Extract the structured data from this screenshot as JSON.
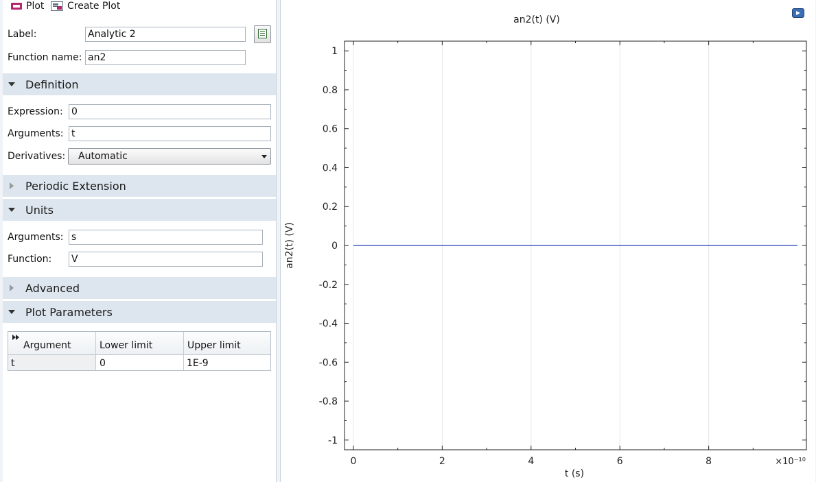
{
  "toolbar": {
    "plot_label": "Plot",
    "plot_icon": "plot-icon",
    "create_plot_label": "Create Plot",
    "create_plot_icon": "create-plot-icon"
  },
  "form": {
    "label_caption": "Label:",
    "label_value": "Analytic 2",
    "function_name_caption": "Function name:",
    "function_name_value": "an2"
  },
  "sections": {
    "definition": "Definition",
    "periodic_extension": "Periodic Extension",
    "units": "Units",
    "advanced": "Advanced",
    "plot_parameters": "Plot Parameters"
  },
  "definition": {
    "expression_caption": "Expression:",
    "expression_value": "0",
    "arguments_caption": "Arguments:",
    "arguments_value": "t",
    "derivatives_caption": "Derivatives:",
    "derivatives_value": "Automatic"
  },
  "units": {
    "arguments_caption": "Arguments:",
    "arguments_value": "s",
    "function_caption": "Function:",
    "function_value": "V"
  },
  "plot_parameters": {
    "columns": [
      "Argument",
      "Lower limit",
      "Upper limit"
    ],
    "rows": [
      [
        "t",
        "0",
        "1E-9"
      ]
    ]
  },
  "colors": {
    "section_bg": "#dde6ef",
    "line": "#1f3fbf",
    "grid": "#e6e6e6"
  },
  "chart_data": {
    "type": "line",
    "title": "an2(t) (V)",
    "xlabel": "t (s)",
    "ylabel": "an2(t) (V)",
    "x_multiplier": "×10⁻¹⁰",
    "xlim": [
      -0.2,
      10.2
    ],
    "ylim": [
      -1.05,
      1.05
    ],
    "xticks": [
      0,
      2,
      4,
      6,
      8
    ],
    "yticks": [
      1,
      0.8,
      0.6,
      0.4,
      0.2,
      0,
      -0.2,
      -0.4,
      -0.6,
      -0.8,
      -1
    ],
    "grid": true,
    "series": [
      {
        "x": [
          0,
          10
        ],
        "y": [
          0,
          0
        ]
      }
    ]
  }
}
